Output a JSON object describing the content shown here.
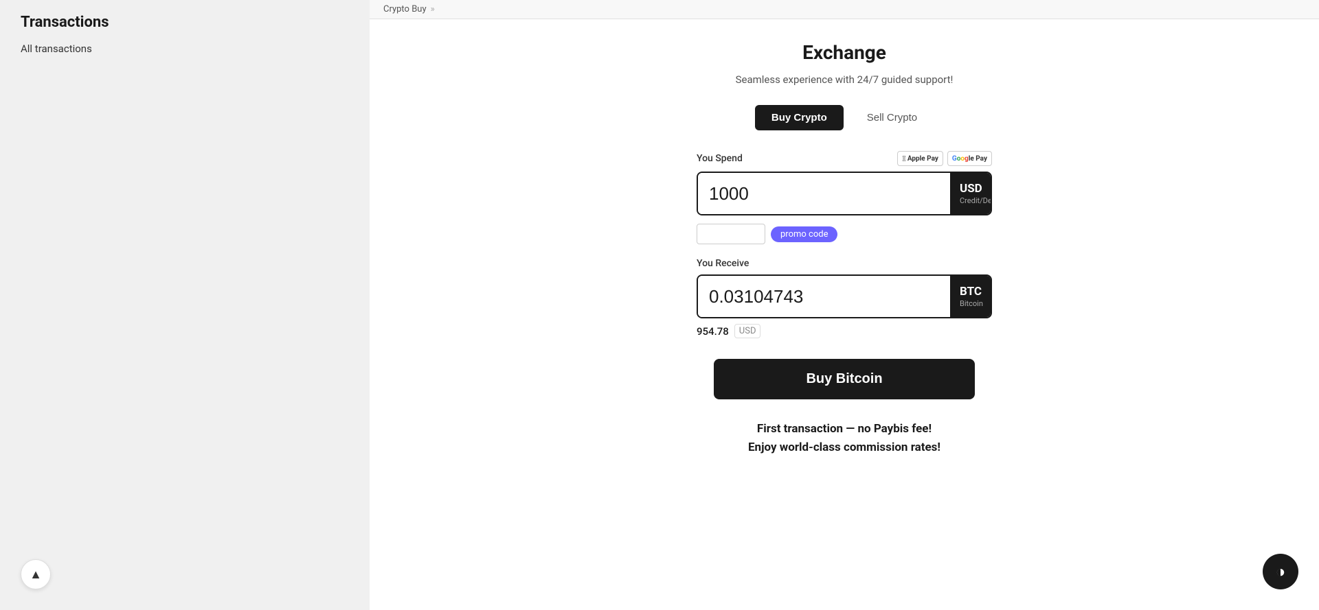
{
  "sidebar": {
    "title": "Transactions",
    "links": [
      {
        "label": "All transactions",
        "id": "all-transactions"
      }
    ]
  },
  "breadcrumb": {
    "items": [
      "Crypto Buy",
      "»"
    ]
  },
  "exchange": {
    "title": "Exchange",
    "subtitle": "Seamless experience with 24/7 guided support!",
    "buy_label": "Buy Crypto",
    "sell_label": "Sell Crypto",
    "spend_label": "You Spend",
    "receive_label": "You Receive",
    "spend_amount": "1000",
    "receive_amount": "0.03104743",
    "currency_code": "USD",
    "currency_subtext": "Credit/Debit Card",
    "btc_code": "BTC",
    "btc_name": "Bitcoin",
    "promo_placeholder": "",
    "promo_badge": "promo code",
    "rate_value": "954.78",
    "rate_currency": "USD",
    "buy_bitcoin_label": "Buy Bitcoin",
    "promo_text_line1": "First transaction — no Paybis fee!",
    "promo_text_line2": "Enjoy world-class commission rates!",
    "apple_pay": "Apple Pay",
    "google_pay": "Google Pay"
  },
  "ui": {
    "scroll_up_icon": "▲",
    "chevron_down": "▾",
    "theme_icon": "◑"
  }
}
